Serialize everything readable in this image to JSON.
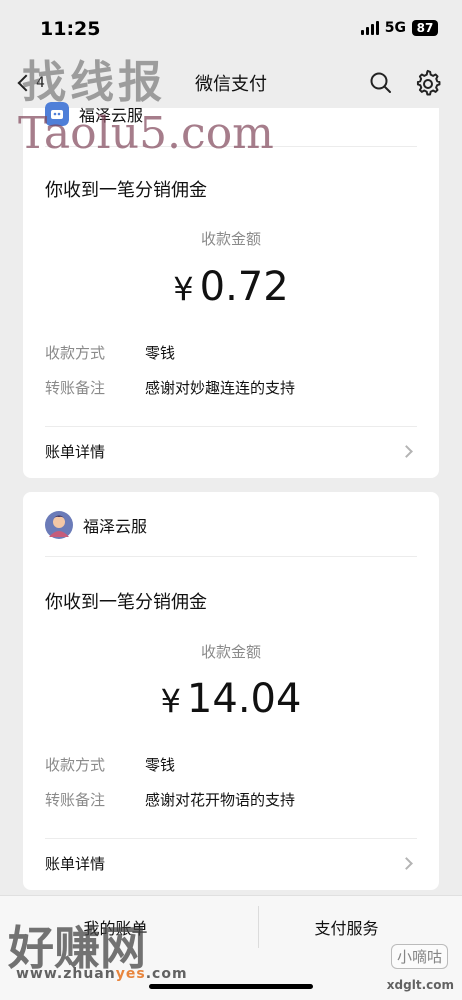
{
  "status_bar": {
    "time": "11:25",
    "network": "5G",
    "battery": "87"
  },
  "nav": {
    "back_count": "4",
    "title": "微信支付"
  },
  "cards": [
    {
      "merchant": "福泽云服",
      "heading": "你收到一笔分销佣金",
      "amount_label": "收款金额",
      "currency": "¥",
      "amount": "0.72",
      "details": [
        {
          "key": "收款方式",
          "value": "零钱"
        },
        {
          "key": "转账备注",
          "value": "感谢对妙趣连连的支持"
        }
      ],
      "bill_label": "账单详情"
    },
    {
      "merchant": "福泽云服",
      "heading": "你收到一笔分销佣金",
      "amount_label": "收款金额",
      "currency": "¥",
      "amount": "14.04",
      "details": [
        {
          "key": "收款方式",
          "value": "零钱"
        },
        {
          "key": "转账备注",
          "value": "感谢对花开物语的支持"
        }
      ],
      "bill_label": "账单详情"
    }
  ],
  "bottom_tabs": {
    "left": "我的账单",
    "right": "支付服务"
  },
  "watermarks": {
    "top": "找线报",
    "taolu": "Taolu5.com",
    "bottom_left": "好赚网",
    "url_prefix": "www.zhuan",
    "url_accent": "yes",
    "url_suffix": ".com",
    "xdglt": "xdglt.com",
    "small_box": "小嘀咕"
  },
  "colors": {
    "background": "#ededed",
    "card": "#ffffff",
    "secondary_text": "#8a8a8a"
  }
}
